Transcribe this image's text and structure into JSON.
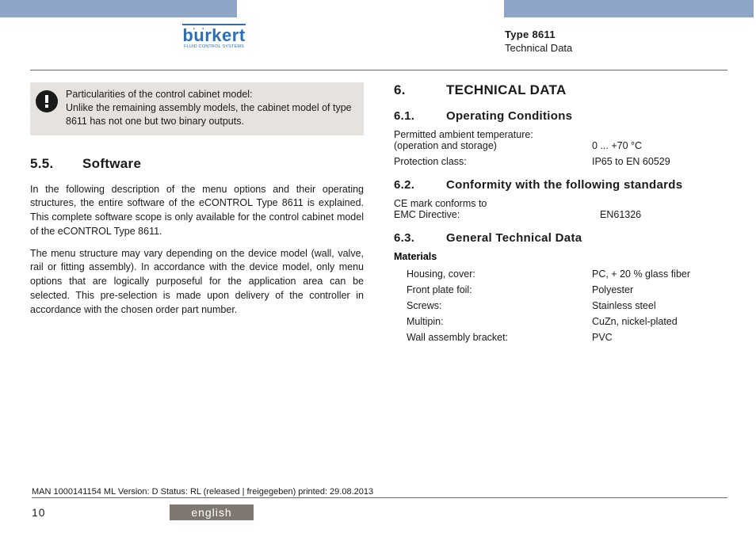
{
  "brand": {
    "name": "burkert",
    "tagline": "FLUID CONTROL SYSTEMS"
  },
  "header": {
    "type_line": "Type 8611",
    "section_line": "Technical Data"
  },
  "left": {
    "callout": {
      "line1": "Particularities of the control cabinet model:",
      "line2": "Unlike the remaining assembly models, the cabinet model of type 8611 has not one but two binary outputs."
    },
    "h55_num": "5.5.",
    "h55_title": "Software",
    "p1": "In the following description of the menu options and their operating structures, the entire software of the eCONTROL Type 8611 is explained. This complete software scope is only available for the control cabinet model of the eCONTROL Type 8611.",
    "p2": "The menu structure may vary depending on the device model (wall, valve, rail or fitting assembly). In accordance with the device model, only menu options that are logically purposeful for the application area can be selected. This pre-selection is made upon delivery of the controller in accordance with the chosen order part number."
  },
  "right": {
    "h6_num": "6.",
    "h6_title": "TECHNICAL DATA",
    "h61_num": "6.1.",
    "h61_title": "Operating Conditions",
    "oc": {
      "temp_lbl1": "Permitted ambient temperature:",
      "temp_lbl2": "(operation and storage)",
      "temp_val": "0 ... +70 °C",
      "prot_lbl": "Protection class:",
      "prot_val": "IP65 to EN 60529"
    },
    "h62_num": "6.2.",
    "h62_title": "Conformity with the following standards",
    "conf": {
      "ce_lbl1": "CE mark conforms to",
      "ce_lbl2": "EMC Directive:",
      "ce_val": "EN61326"
    },
    "h63_num": "6.3.",
    "h63_title": "General Technical Data",
    "mat_title": "Materials",
    "mat": {
      "housing_lbl": "Housing, cover:",
      "housing_val": "PC, + 20 % glass fiber",
      "front_lbl": "Front plate foil:",
      "front_val": "Polyester",
      "screws_lbl": "Screws:",
      "screws_val": "Stainless steel",
      "multipin_lbl": "Multipin:",
      "multipin_val": "CuZn, nickel-plated",
      "bracket_lbl": "Wall assembly bracket:",
      "bracket_val": "PVC"
    }
  },
  "footer": {
    "meta": "MAN  1000141154  ML   Version: D Status: RL  (released | freigegeben)   printed: 29.08.2013",
    "page": "10",
    "language": "english"
  }
}
